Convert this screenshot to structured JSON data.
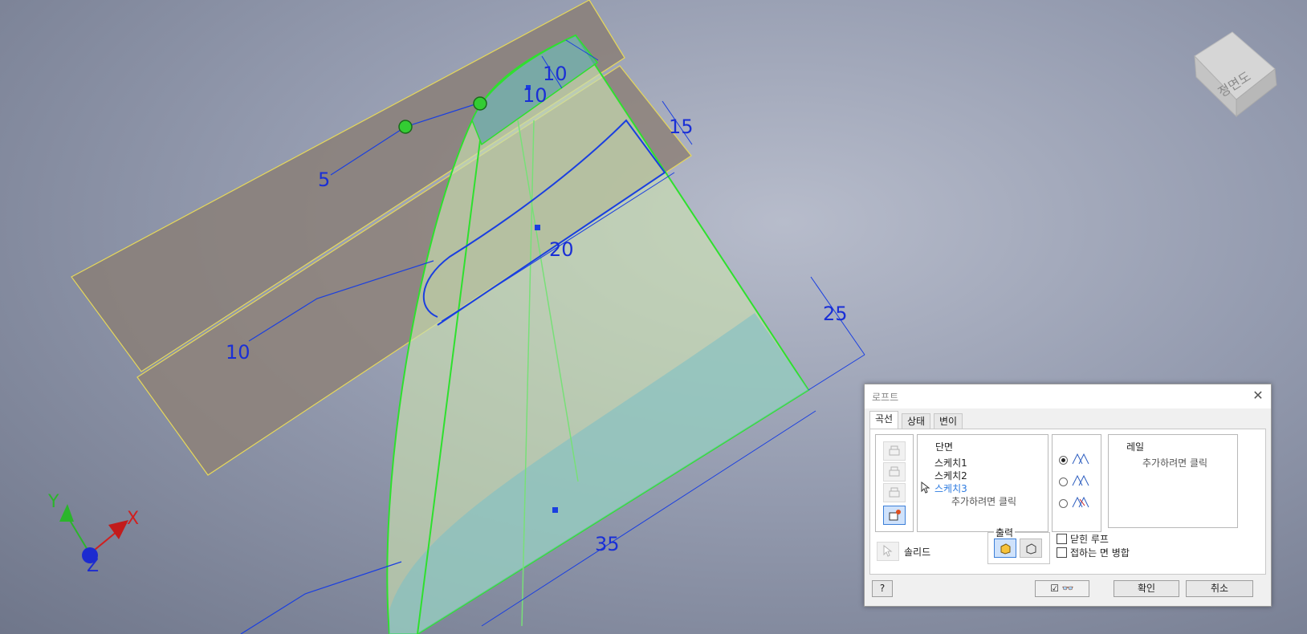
{
  "viewcube": {
    "label": "정면도"
  },
  "dimensions": [
    "10",
    "10",
    "15",
    "5",
    "20",
    "10",
    "25",
    "35"
  ],
  "axes": {
    "x": "X",
    "y": "Y",
    "z": "Z"
  },
  "dialog": {
    "title": "로프트",
    "tabs": [
      "곡선",
      "상태",
      "변이"
    ],
    "sections": {
      "header": "단면",
      "items": [
        "스케치1",
        "스케치2",
        "스케치3"
      ],
      "add_hint": "추가하려면 클릭"
    },
    "rails": {
      "header": "레일",
      "add_hint": "추가하려면 클릭"
    },
    "solid_label": "솔리드",
    "output": {
      "label": "출력"
    },
    "options": {
      "closed_loop": "닫힌 루프",
      "merge_tangent": "접하는 면 병합"
    },
    "buttons": {
      "ok": "확인",
      "cancel": "취소"
    }
  }
}
